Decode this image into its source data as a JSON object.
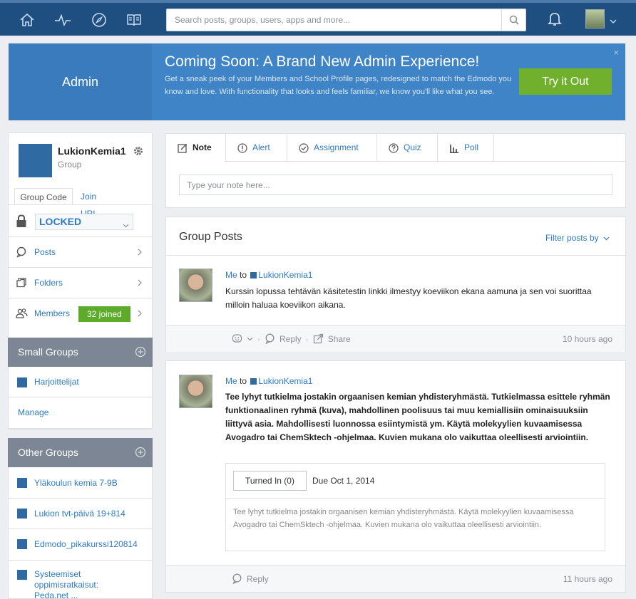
{
  "topbar": {
    "search_placeholder": "Search posts, groups, users, apps and more...",
    "nav_icons": [
      "home-icon",
      "activity-icon",
      "discover-icon",
      "library-icon"
    ]
  },
  "banner": {
    "admin_label": "Admin",
    "title": "Coming Soon: A Brand New Admin Experience!",
    "body": "Get a sneak peek of your Members and School Profile pages, redesigned to match the Edmodo you know and love. With functionality that looks and feels familiar, we know you'll like what you see.",
    "cta": "Try it Out",
    "close": "×"
  },
  "group": {
    "name": "LukionKemia1",
    "type": "Group",
    "tab_code": "Group Code",
    "tab_join": "Join URL",
    "lock_status": "LOCKED",
    "nav": [
      {
        "label": "Posts"
      },
      {
        "label": "Folders"
      },
      {
        "label": "Members",
        "badge": "32 joined"
      }
    ]
  },
  "small_groups": {
    "title": "Small Groups",
    "items": [
      "Harjoittelijat"
    ],
    "manage": "Manage"
  },
  "other_groups": {
    "title": "Other Groups",
    "items": [
      "Yläkoulun kemia 7-9B",
      "Lukion tvt-päivä 19+814",
      "Edmodo_pikakurssi120814",
      "Systeemiset oppimisratkaisut: Peda.net ..."
    ]
  },
  "composer": {
    "tabs": [
      "Note",
      "Alert",
      "Assignment",
      "Quiz",
      "Poll"
    ],
    "placeholder": "Type your note here..."
  },
  "posts": {
    "title": "Group Posts",
    "filter": "Filter posts by",
    "items": [
      {
        "author": "Me",
        "to": "to",
        "group": "LukionKemia1",
        "text": "Kurssin lopussa tehtävän käsitetestin linkki ilmestyy koeviikon ekana aamuna ja sen voi suorittaa milloin haluaa koeviikon aikana.",
        "reply": "Reply",
        "share": "Share",
        "time": "10 hours ago"
      },
      {
        "author": "Me",
        "to": "to",
        "group": "LukionKemia1",
        "text": "Tee lyhyt tutkielma jostakin orgaanisen kemian yhdisteryhmästä. Tutkielmassa esittele ryhmän funktionaalinen ryhmä (kuva), mahdollinen poolisuus tai muu kemiallisiin ominaisuuksiin liittyvä asia. Mahdollisesti luonnossa esiintymistä ym. Käytä molekyylien kuvaamisessa Avogadro tai ChemSktech -ohjelmaa. Kuvien mukana olo vaikuttaa oleellisesti arviointiin.",
        "turned_in": "Turned In (0)",
        "due": "Due Oct 1, 2014",
        "assignment_desc": "Tee lyhyt tutkielma jostakin orgaanisen kemian yhdisteryhmästä. Käytä molekyylien kuvaamisessa Avogadro tai ChemSktech -ohjelmaa. Kuvien mukana olo vaikuttaa oleellisesti arviointiin.",
        "reply": "Reply",
        "time": "11 hours ago"
      }
    ]
  },
  "colors": {
    "topbar": "#1e4f80",
    "banner": "#3e84c6",
    "cta": "#71b02c",
    "link": "#2e7bc4",
    "badge": "#5eab2b",
    "section_header": "#7d8695"
  }
}
